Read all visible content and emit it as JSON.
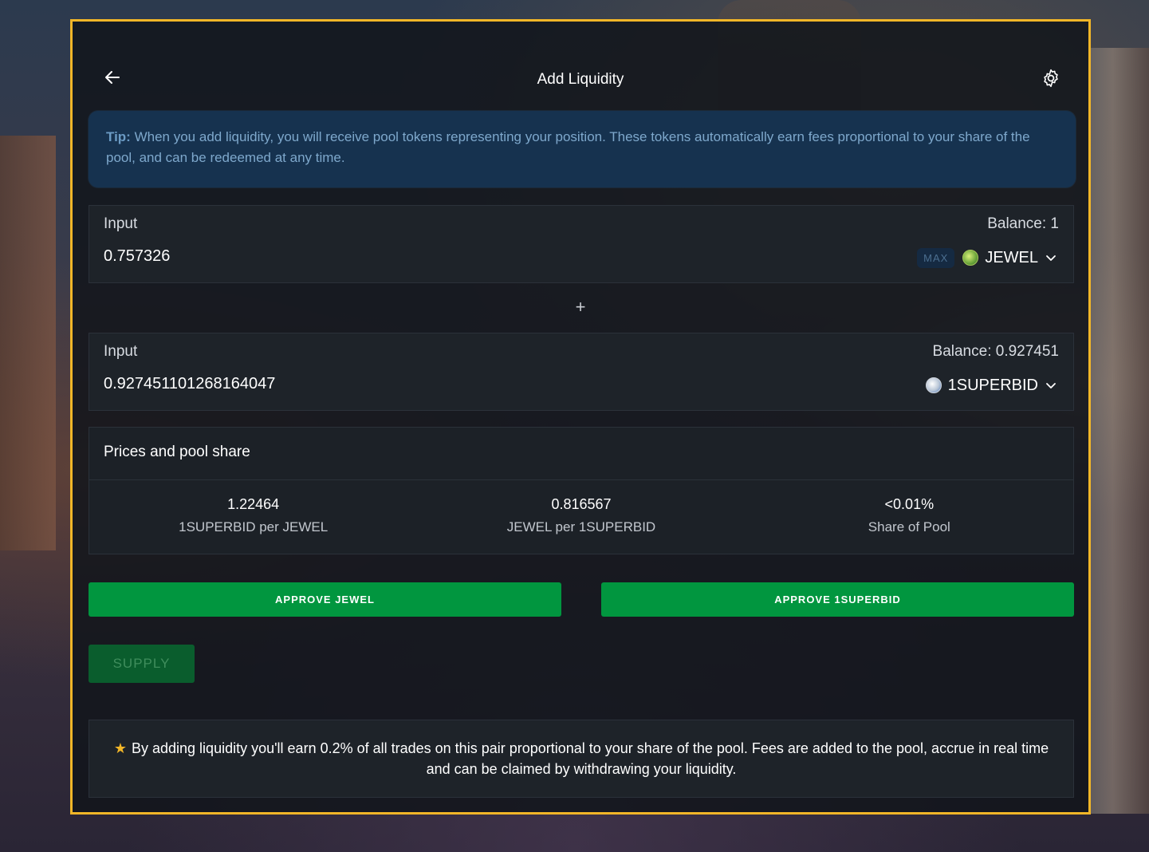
{
  "header": {
    "title": "Add Liquidity",
    "back_icon": "arrow-left-icon",
    "settings_icon": "gear-icon"
  },
  "tip": {
    "label": "Tip:",
    "text": "When you add liquidity, you will receive pool tokens representing your position. These tokens automatically earn fees proportional to your share of the pool, and can be redeemed at any time."
  },
  "input1": {
    "label": "Input",
    "balance": "Balance: 1",
    "value": "0.757326",
    "max_label": "MAX",
    "token": "JEWEL"
  },
  "plus": "+",
  "input2": {
    "label": "Input",
    "balance": "Balance: 0.927451",
    "value": "0.927451101268164047",
    "token": "1SUPERBID"
  },
  "prices": {
    "title": "Prices and pool share",
    "items": [
      {
        "value": "1.22464",
        "label": "1SUPERBID per JEWEL"
      },
      {
        "value": "0.816567",
        "label": "JEWEL per 1SUPERBID"
      },
      {
        "value": "<0.01%",
        "label": "Share of Pool"
      }
    ]
  },
  "buttons": {
    "approve_jewel": "APPROVE JEWEL",
    "approve_superbid": "APPROVE 1SUPERBID",
    "supply": "SUPPLY"
  },
  "note": {
    "star": "★",
    "text": "By adding liquidity you'll earn 0.2% of all trades on this pair proportional to your share of the pool. Fees are added to the pool, accrue in real time and can be claimed by withdrawing your liquidity."
  },
  "colors": {
    "frame_border": "#f2b628",
    "approve_green": "#01963f",
    "supply_disabled": "#0a5d2d",
    "tip_bg": "#16324f"
  }
}
